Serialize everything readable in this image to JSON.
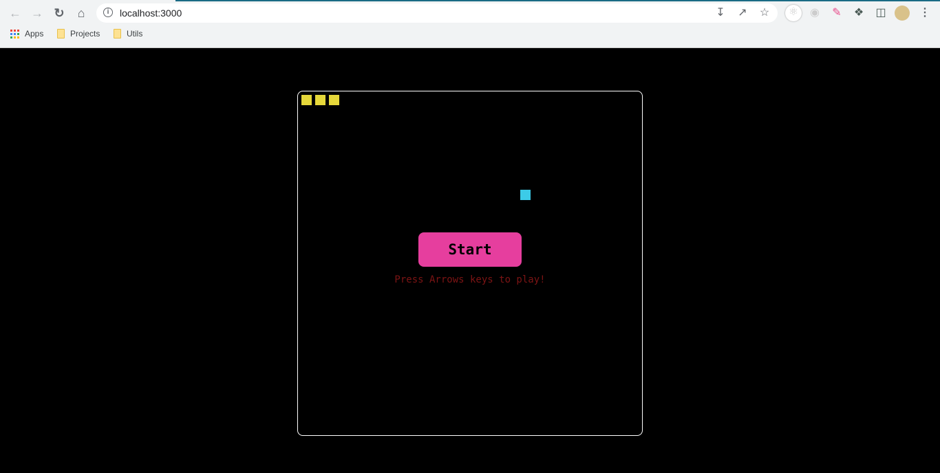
{
  "browser": {
    "url": "localhost:3000",
    "bookmarks": [
      {
        "label": "Apps",
        "icon": "apps-grid-icon"
      },
      {
        "label": "Projects",
        "icon": "folder-icon"
      },
      {
        "label": "Utils",
        "icon": "folder-icon"
      }
    ]
  },
  "game": {
    "start_label": "Start",
    "hint": "Press Arrows keys to play!",
    "snake_color": "#e6d83a",
    "food_color": "#3ccbe8",
    "button_color": "#e63e9e",
    "snake_length": 3
  }
}
